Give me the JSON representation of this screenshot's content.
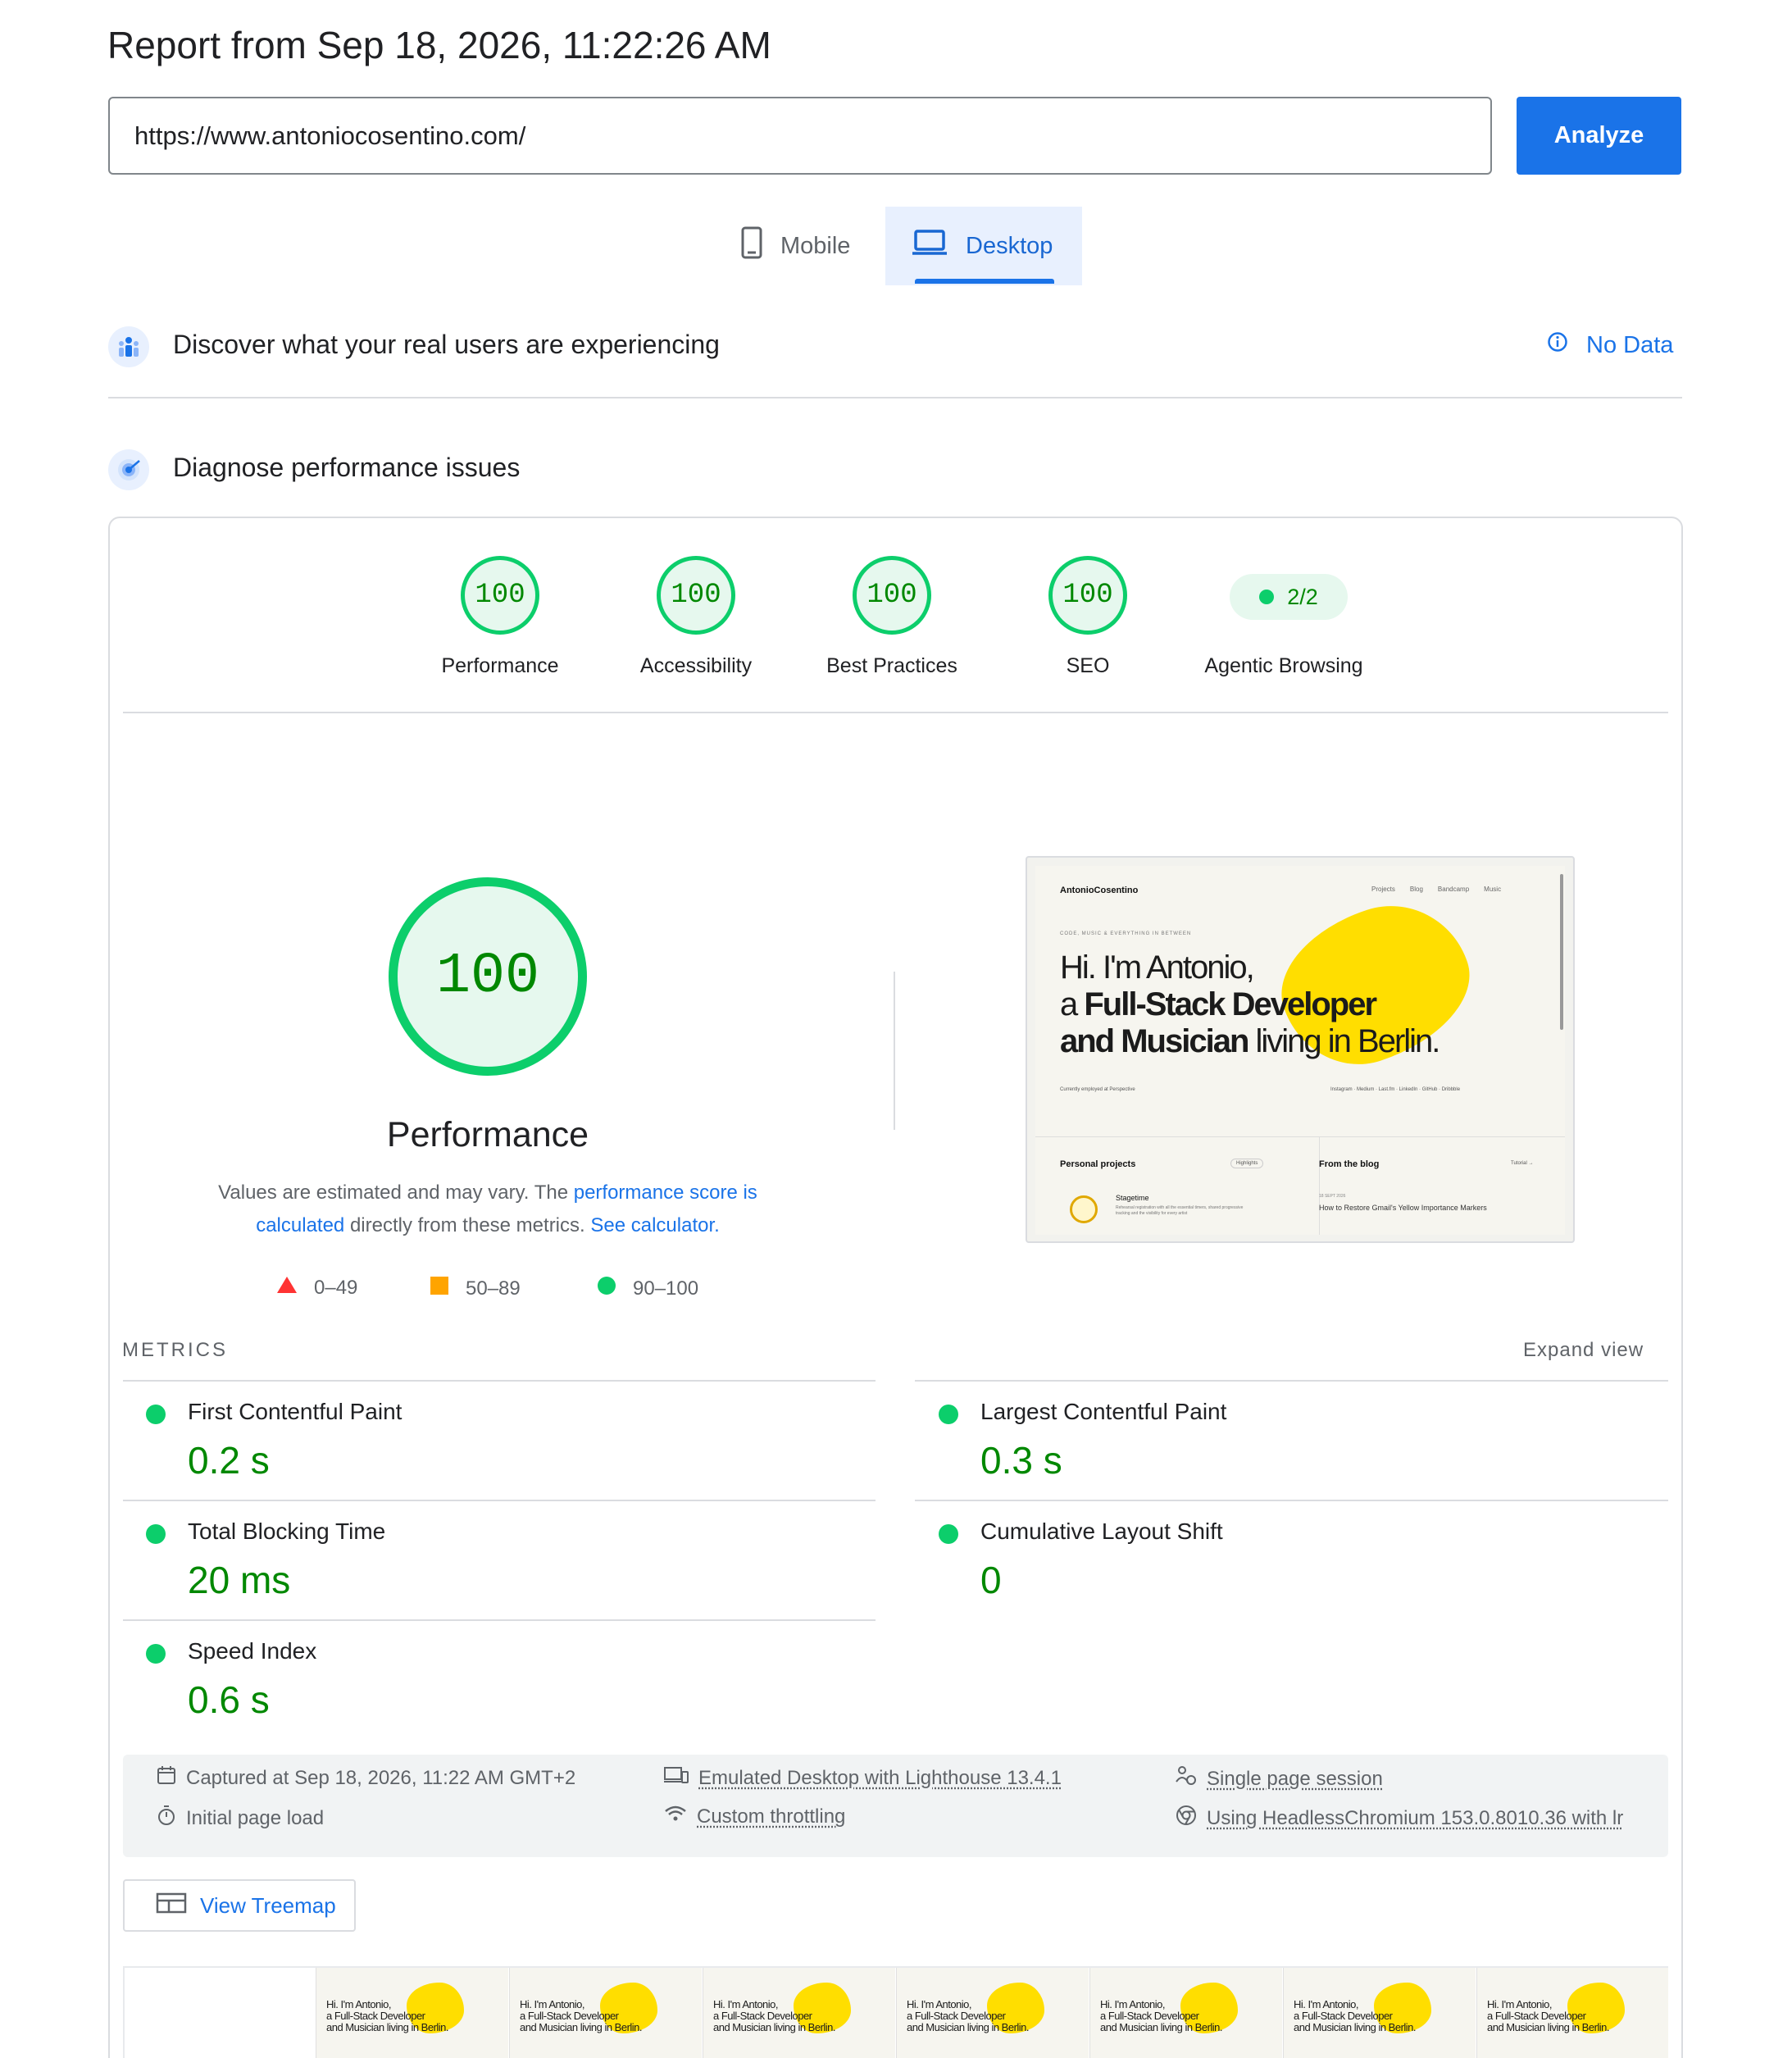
{
  "header": {
    "report_title": "Report from Sep 18, 2026, 11:22:26 AM",
    "url_value": "https://www.antoniocosentino.com/",
    "analyze_label": "Analyze"
  },
  "device_tabs": {
    "mobile": "Mobile",
    "desktop": "Desktop",
    "selected": "Desktop"
  },
  "field_data": {
    "title": "Discover what your real users are experiencing",
    "status": "No Data"
  },
  "lab_data": {
    "title": "Diagnose performance issues"
  },
  "categories": [
    {
      "label": "Performance",
      "score": "100"
    },
    {
      "label": "Accessibility",
      "score": "100"
    },
    {
      "label": "Best Practices",
      "score": "100"
    },
    {
      "label": "SEO",
      "score": "100"
    },
    {
      "label": "Agentic Browsing",
      "score": "2/2"
    }
  ],
  "performance": {
    "score": "100",
    "title": "Performance",
    "desc_pre": "Values are estimated and may vary. The ",
    "desc_link1": "performance score is calculated",
    "desc_mid": " directly from these metrics. ",
    "desc_link2": "See calculator.",
    "legend": {
      "fail": "0–49",
      "average": "50–89",
      "pass": "90–100"
    }
  },
  "screenshot": {
    "brand": "AntonioCosentino",
    "nav": [
      "Projects",
      "Blog",
      "Bandcamp",
      "Music"
    ],
    "tagline": "CODE, MUSIC & EVERYTHING IN BETWEEN",
    "hero_line1": "Hi. I'm Antonio,",
    "hero_line2_pre": "a ",
    "hero_line2_bold": "Full-Stack Developer",
    "hero_line3_bold": "and Musician",
    "hero_line3_post": " living in Berlin.",
    "byline": "Currently employed at Perspective",
    "socials": "Instagram · Medium · Last.fm · LinkedIn · GitHub · Dribbble",
    "projects_title": "Personal projects",
    "projects_badge": "Highlights",
    "project_name": "Stagetime",
    "project_desc": "Rehearsal registration with all the essential timers, shared progressive tracking and the visibility for every artist",
    "blog_title": "From the blog",
    "blog_all": "Tutorial →",
    "blog_date": "18 SEPT 2026",
    "blog_post": "How to Restore Gmail's Yellow Importance Markers"
  },
  "metrics": {
    "label": "METRICS",
    "expand": "Expand view",
    "items": [
      {
        "name": "First Contentful Paint",
        "value": "0.2 s"
      },
      {
        "name": "Largest Contentful Paint",
        "value": "0.3 s"
      },
      {
        "name": "Total Blocking Time",
        "value": "20 ms"
      },
      {
        "name": "Cumulative Layout Shift",
        "value": "0"
      },
      {
        "name": "Speed Index",
        "value": "0.6 s"
      }
    ]
  },
  "run_info": {
    "captured": "Captured at Sep 18, 2026, 11:22 AM GMT+2",
    "page_load": "Initial page load",
    "emulated": "Emulated Desktop with Lighthouse 13.4.1",
    "throttling": "Custom throttling",
    "session": "Single page session",
    "browser": "Using HeadlessChromium 153.0.8010.36 with lr"
  },
  "treemap_label": "View Treemap",
  "filmstrip": {
    "frame_line1": "Hi. I'm Antonio,",
    "frame_line2": "a Full-Stack Developer",
    "frame_line3": "and Musician living in Berlin."
  },
  "colors": {
    "pass": "#0cce6b",
    "pass_text": "#008800",
    "pass_bg": "#e6f8ee",
    "accent": "#1a73e8",
    "fail": "#ff3333",
    "average": "#ffa400",
    "blob": "#ffde00"
  },
  "icons": [
    "mobile-phone-icon",
    "laptop-icon",
    "users-icon",
    "info-icon",
    "target-icon",
    "calendar-icon",
    "stopwatch-icon",
    "devices-icon",
    "wifi-icon",
    "people-icon",
    "chrome-icon",
    "treemap-icon"
  ]
}
